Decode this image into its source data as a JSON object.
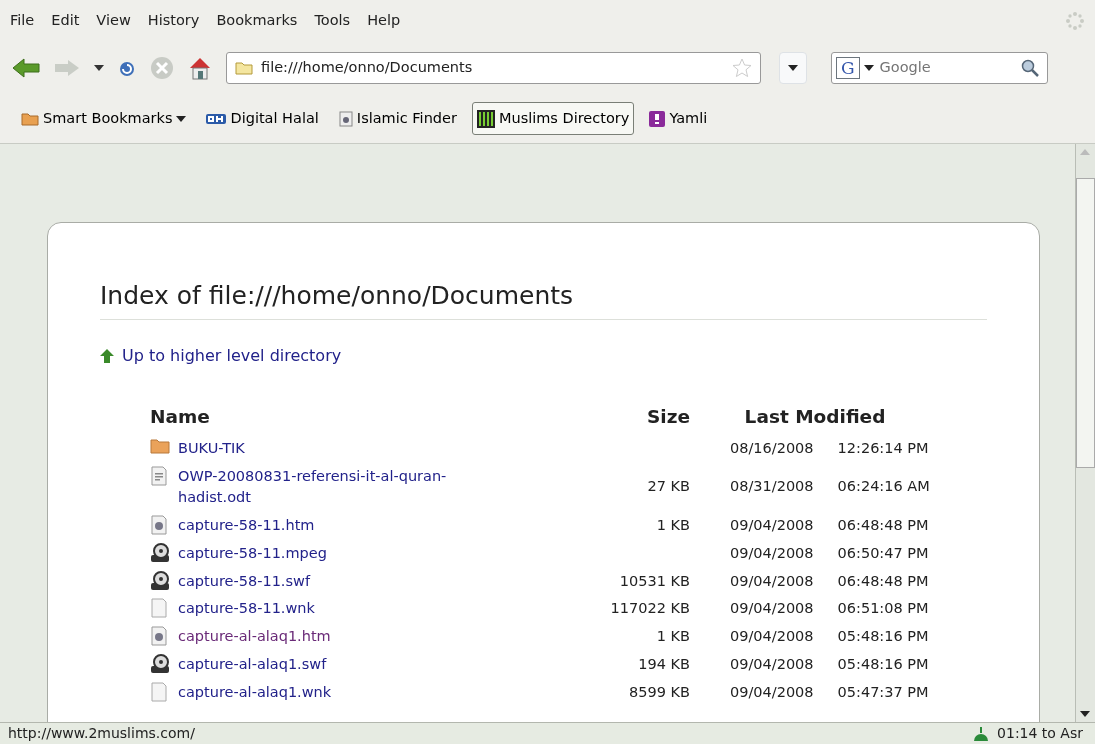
{
  "menu": [
    "File",
    "Edit",
    "View",
    "History",
    "Bookmarks",
    "Tools",
    "Help"
  ],
  "address": {
    "value": "file:///home/onno/Documents"
  },
  "search": {
    "engine": "G",
    "placeholder": "Google"
  },
  "bookmarks": [
    {
      "label": "Smart Bookmarks",
      "kind": "menu",
      "hovered": false
    },
    {
      "label": "Digital Halal",
      "kind": "oh",
      "hovered": false
    },
    {
      "label": "Islamic Finder",
      "kind": "page",
      "hovered": false
    },
    {
      "label": "Muslims Directory",
      "kind": "bars",
      "hovered": true
    },
    {
      "label": "Yamli",
      "kind": "yamli",
      "hovered": false
    }
  ],
  "listing": {
    "title": "Index of file:///home/onno/Documents",
    "up_link": "Up to higher level directory",
    "columns": [
      "Name",
      "Size",
      "Last Modified"
    ],
    "rows": [
      {
        "kind": "folder",
        "name": "BUKU-TIK",
        "size": "",
        "date": "08/16/2008",
        "time": "12:26:14 PM",
        "visited": false
      },
      {
        "kind": "document",
        "name": "OWP-20080831-referensi-it-al-quran-hadist.odt",
        "size": "27 KB",
        "date": "08/31/2008",
        "time": "06:24:16 AM",
        "visited": false
      },
      {
        "kind": "web",
        "name": "capture-58-11.htm",
        "size": "1 KB",
        "date": "09/04/2008",
        "time": "06:48:48 PM",
        "visited": false
      },
      {
        "kind": "video",
        "name": "capture-58-11.mpeg",
        "size": "",
        "date": "09/04/2008",
        "time": "06:50:47 PM",
        "visited": false
      },
      {
        "kind": "video",
        "name": "capture-58-11.swf",
        "size": "10531 KB",
        "date": "09/04/2008",
        "time": "06:48:48 PM",
        "visited": false
      },
      {
        "kind": "blank",
        "name": "capture-58-11.wnk",
        "size": "117022 KB",
        "date": "09/04/2008",
        "time": "06:51:08 PM",
        "visited": false
      },
      {
        "kind": "web",
        "name": "capture-al-alaq1.htm",
        "size": "1 KB",
        "date": "09/04/2008",
        "time": "05:48:16 PM",
        "visited": true
      },
      {
        "kind": "video",
        "name": "capture-al-alaq1.swf",
        "size": "194 KB",
        "date": "09/04/2008",
        "time": "05:48:16 PM",
        "visited": false
      },
      {
        "kind": "blank",
        "name": "capture-al-alaq1.wnk",
        "size": "8599 KB",
        "date": "09/04/2008",
        "time": "05:47:37 PM",
        "visited": false
      }
    ]
  },
  "status_bar": {
    "url": "http://www.2muslims.com/",
    "prayer": "01:14 to Asr"
  }
}
